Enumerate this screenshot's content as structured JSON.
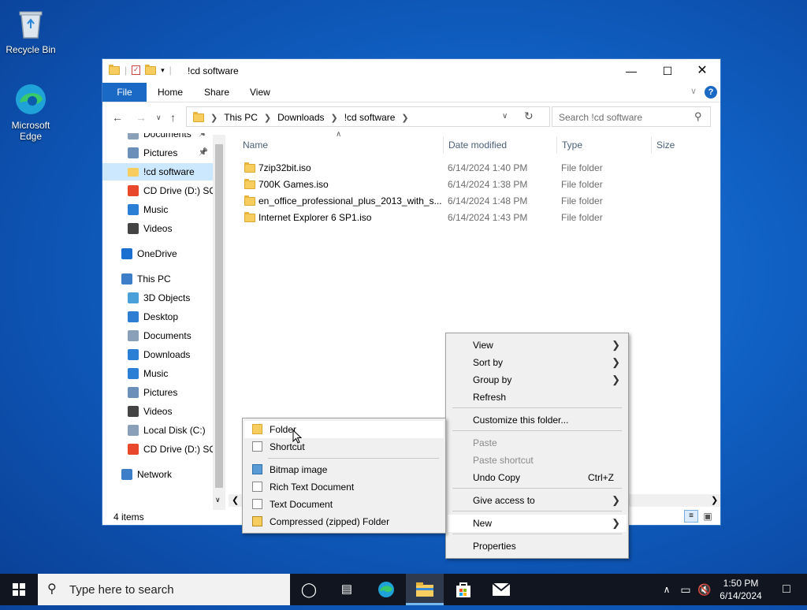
{
  "desktop": {
    "icons": [
      {
        "label": "Recycle Bin"
      },
      {
        "label": "Microsoft Edge"
      }
    ]
  },
  "window": {
    "title": "!cd software",
    "ribbon_tabs": [
      "File",
      "Home",
      "Share",
      "View"
    ],
    "breadcrumbs": [
      "This PC",
      "Downloads",
      "!cd software"
    ],
    "search_placeholder": "Search !cd software",
    "nav_items": [
      {
        "label": "Documents",
        "pinned": true
      },
      {
        "label": "Pictures",
        "pinned": true
      },
      {
        "label": "!cd software",
        "selected": true
      },
      {
        "label": "CD Drive (D:) SQ"
      },
      {
        "label": "Music"
      },
      {
        "label": "Videos"
      },
      {
        "label": "OneDrive"
      },
      {
        "label": "This PC"
      },
      {
        "label": "3D Objects"
      },
      {
        "label": "Desktop"
      },
      {
        "label": "Documents"
      },
      {
        "label": "Downloads"
      },
      {
        "label": "Music"
      },
      {
        "label": "Pictures"
      },
      {
        "label": "Videos"
      },
      {
        "label": "Local Disk (C:)"
      },
      {
        "label": "CD Drive (D:) SQ"
      },
      {
        "label": "Network"
      }
    ],
    "columns": [
      "Name",
      "Date modified",
      "Type",
      "Size"
    ],
    "files": [
      {
        "name": "7zip32bit.iso",
        "date": "6/14/2024 1:40 PM",
        "type": "File folder"
      },
      {
        "name": "700K Games.iso",
        "date": "6/14/2024 1:38 PM",
        "type": "File folder"
      },
      {
        "name": "en_office_professional_plus_2013_with_s...",
        "date": "6/14/2024 1:48 PM",
        "type": "File folder"
      },
      {
        "name": "Internet Explorer 6 SP1.iso",
        "date": "6/14/2024 1:43 PM",
        "type": "File folder"
      }
    ],
    "status": "4 items"
  },
  "context_menu": {
    "items": [
      {
        "label": "View",
        "submenu": true
      },
      {
        "label": "Sort by",
        "submenu": true
      },
      {
        "label": "Group by",
        "submenu": true
      },
      {
        "label": "Refresh"
      },
      {
        "label": "Customize this folder..."
      },
      {
        "label": "Paste",
        "disabled": true
      },
      {
        "label": "Paste shortcut",
        "disabled": true
      },
      {
        "label": "Undo Copy",
        "shortcut": "Ctrl+Z"
      },
      {
        "label": "Give access to",
        "submenu": true
      },
      {
        "label": "New",
        "submenu": true,
        "highlighted": true
      },
      {
        "label": "Properties"
      }
    ]
  },
  "new_submenu": {
    "items": [
      {
        "label": "Folder",
        "icon": "folder-icon"
      },
      {
        "label": "Shortcut",
        "icon": "shortcut-icon"
      },
      {
        "label": "Bitmap image",
        "icon": "bitmap-icon"
      },
      {
        "label": "Rich Text Document",
        "icon": "rtf-doc-icon"
      },
      {
        "label": "Text Document",
        "icon": "text-doc-icon"
      },
      {
        "label": "Compressed (zipped) Folder",
        "icon": "zip-folder-icon"
      }
    ]
  },
  "taskbar": {
    "search_placeholder": "Type here to search",
    "time": "1:50 PM",
    "date": "6/14/2024"
  },
  "colors": {
    "accent": "#1a69c4",
    "selection": "#cce8ff",
    "taskbar": "#101520"
  }
}
